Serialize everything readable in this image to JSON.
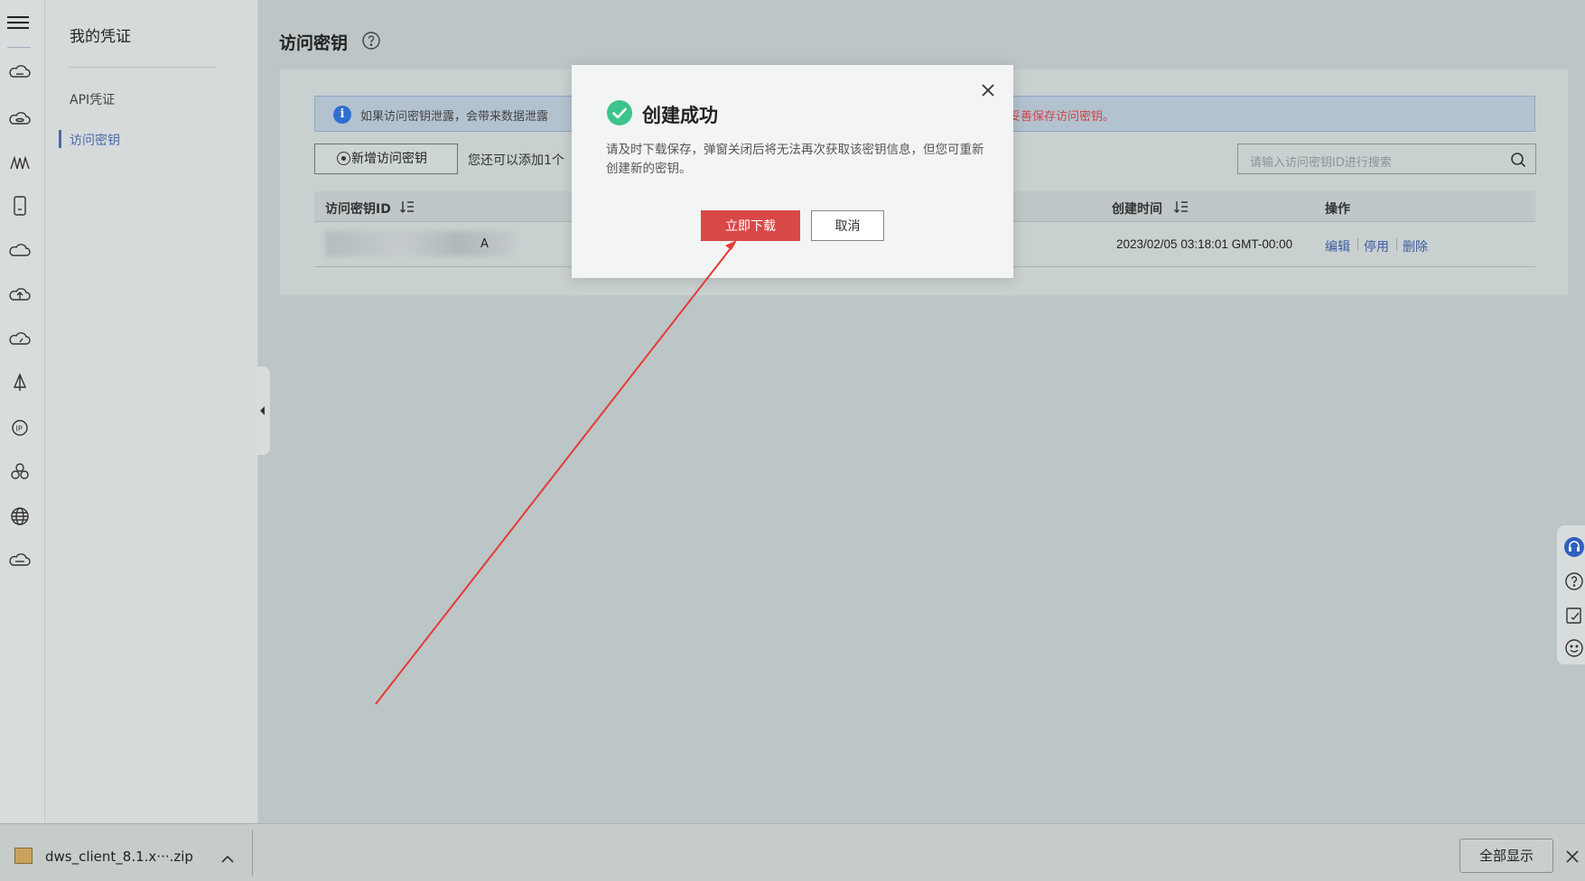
{
  "sidebar": {
    "title": "我的凭证",
    "items": [
      {
        "label": "API凭证",
        "active": false
      },
      {
        "label": "访问密钥",
        "active": true
      }
    ]
  },
  "rail_icons": [
    "cloud-icon",
    "cloud-database-icon",
    "mountain-chart-icon",
    "phone-icon",
    "cloud-outline-icon",
    "cloud-upload-icon",
    "cloud-gauge-icon",
    "sail-icon",
    "ip-icon",
    "cluster-icon",
    "globe-icon",
    "cloud-stack-icon"
  ],
  "main": {
    "title": "访问密钥",
    "notice": {
      "text": "如果访问密钥泄露，会带来数据泄露",
      "warning": "妥善保存访问密钥。"
    },
    "add_button": "新增访问密钥",
    "hint": "您还可以添加1个",
    "search": {
      "placeholder": "请输入访问密钥ID进行搜索"
    },
    "table": {
      "columns": [
        "访问密钥ID",
        "创建时间",
        "操作"
      ],
      "rows": [
        {
          "id_visible": "A",
          "created": "2023/02/05 03:18:01 GMT-00:00",
          "actions": [
            "编辑",
            "停用",
            "删除"
          ]
        }
      ]
    }
  },
  "modal": {
    "title": "创建成功",
    "body": "请及时下载保存，弹窗关闭后将无法再次获取该密钥信息，但您可重新创建新的密钥。",
    "primary": "立即下载",
    "secondary": "取消"
  },
  "download_bar": {
    "file_name": "dws_client_8.1.x···.zip",
    "show_all": "全部显示"
  },
  "colors": {
    "accent": "#4a6aa8",
    "danger": "#d94848",
    "success": "#3cc48a",
    "info": "#2f6fd0",
    "annotation_arrow": "#e53935"
  }
}
